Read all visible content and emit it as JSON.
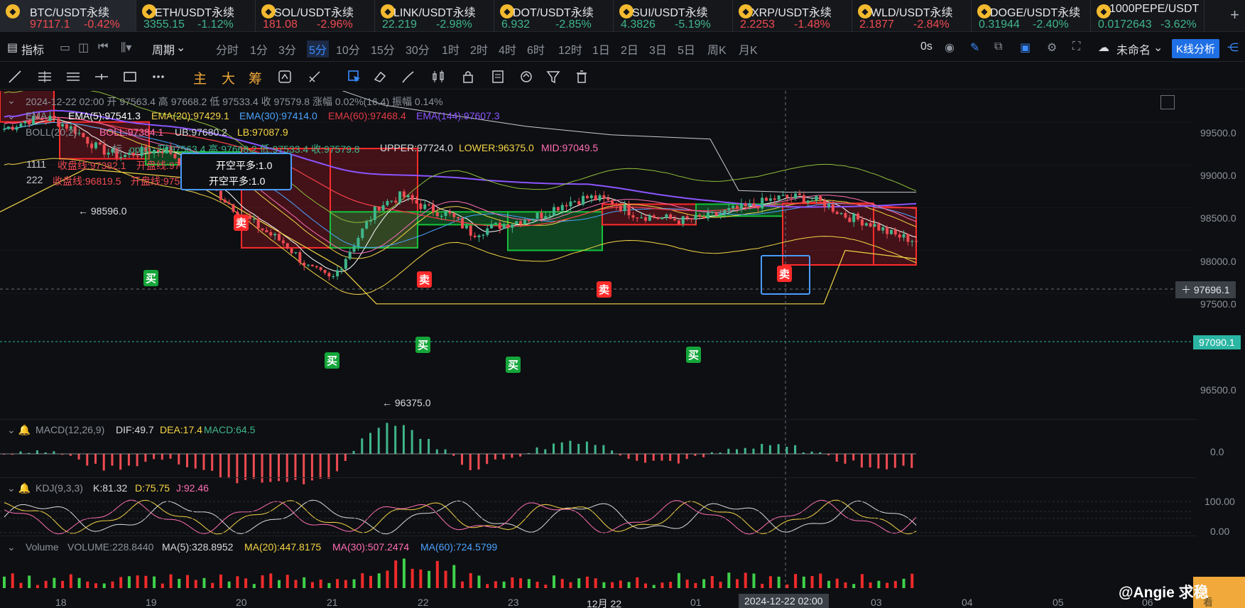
{
  "tickers": [
    {
      "name": "BTC/USDT永续",
      "price": "97117.1",
      "change": "-0.42%",
      "dir": "down",
      "active": true,
      "w": 192
    },
    {
      "name": "ETH/USDT永续",
      "price": "3355.15",
      "change": "-1.12%",
      "dir": "up",
      "w": 168
    },
    {
      "name": "SOL/USDT永续",
      "price": "181.08",
      "change": "-2.96%",
      "dir": "down",
      "w": 168
    },
    {
      "name": "LINK/USDT永续",
      "price": "22.219",
      "change": "-2.98%",
      "dir": "up",
      "w": 168
    },
    {
      "name": "DOT/USDT永续",
      "price": "6.932",
      "change": "-2.85%",
      "dir": "up",
      "w": 168
    },
    {
      "name": "SUI/USDT永续",
      "price": "4.3826",
      "change": "-5.19%",
      "dir": "up",
      "w": 168
    },
    {
      "name": "XRP/USDT永续",
      "price": "2.2253",
      "change": "-1.48%",
      "dir": "down",
      "w": 168
    },
    {
      "name": "WLD/USDT永续",
      "price": "2.1877",
      "change": "-2.84%",
      "dir": "down",
      "w": 168
    },
    {
      "name": "DOGE/USDT永续",
      "price": "0.31944",
      "change": "-2.40%",
      "dir": "up",
      "w": 168
    },
    {
      "name": "1000PEPE/USDT",
      "price": "0.0172643",
      "change": "-3.62%",
      "dir": "up",
      "w": 160
    }
  ],
  "toolbar": {
    "indicator": "指标",
    "period": "周期",
    "intervals": [
      "分时",
      "1分",
      "3分",
      "5分",
      "10分",
      "15分",
      "30分",
      "1时",
      "2时",
      "4时",
      "6时",
      "12时",
      "1日",
      "2日",
      "3日",
      "5日",
      "周K",
      "月K"
    ],
    "active_interval": "5分",
    "timer": "0s",
    "layout_name": "未命名",
    "kline_analysis": "K线分析"
  },
  "drawing": {
    "main": "主",
    "big": "大",
    "chip": "筹"
  },
  "legend": {
    "ohlc": "2024-12-22 02:00  开 97563.4  高 97668.2  低 97533.4  收 97579.8  涨幅 0.02%(16.4)  振幅 0.14%",
    "ema_label": "EMA",
    "ema5": "EMA(5):97541.3",
    "ema20": "EMA(20):97429.1",
    "ema30": "EMA(30):97414.0",
    "ema60": "EMA(60):97468.4",
    "ema144": "EMA(144):97607.3",
    "boll_label": "BOLL(20,2)",
    "boll_mid": "BOLL:97384.1",
    "boll_ub": "UB:97680.2",
    "boll_lb": "LB:97087.9",
    "custom_suffix": "标",
    "custom_open": "open: 开:97563.4 高:97668.2 低:97533.4 收:97579.8",
    "custom_upper": "UPPER:97724.0",
    "custom_lower": "LOWER:96375.0",
    "custom_mid": "MID:97049.5",
    "row1_id": "1111",
    "row1_close": "收盘线:97382.1",
    "row1_open": "开盘线:97563.4",
    "row2_id": "222",
    "row2_close": "收盘线:96819.5",
    "row2_open": "开盘线:97563.4",
    "signal1": "开空平多:1.0",
    "signal2": "开空平多:1.0",
    "high_marker": "98596.0",
    "low_marker": "96375.0"
  },
  "signals": {
    "sell": "卖",
    "buy": "买"
  },
  "price_axis": {
    "ticks": [
      "99500.0",
      "99000.0",
      "98500.0",
      "98000.0",
      "97500.0",
      "96500.0"
    ],
    "crosshair_price": "97696.1",
    "last_price": "97090.1",
    "macd_zero": "0.0",
    "kdj_ticks": [
      "100.00",
      "0.00"
    ]
  },
  "macd": {
    "label": "MACD(12,26,9)",
    "dif": "DIF:49.7",
    "dea": "DEA:17.4",
    "macd": "MACD:64.5"
  },
  "kdj": {
    "label": "KDJ(9,3,3)",
    "k": "K:81.32",
    "d": "D:75.75",
    "j": "J:92.46"
  },
  "volume": {
    "label": "Volume",
    "vol": "VOLUME:228.8440",
    "ma5": "MA(5):328.8952",
    "ma20": "MA(20):447.8175",
    "ma30": "MA(30):507.2474",
    "ma60": "MA(60):724.5799"
  },
  "time_axis": {
    "labels": [
      "18",
      "19",
      "20",
      "21",
      "22",
      "23",
      "12月 22",
      "01",
      "02",
      "03",
      "04",
      "05",
      "06"
    ],
    "crosshair_time": "2024-12-22 02:00",
    "edge": "看"
  },
  "watermark": "@Angie 求稳",
  "colors": {
    "up": "#3fb68b",
    "down": "#ef4b52",
    "accent": "#3a8cff",
    "ema5": "#ffffff",
    "ema20": "#f5d547",
    "ema30": "#4aa3ff",
    "ema60": "#e23b45",
    "ema144": "#8b55ff",
    "boll": "#ff6fb5"
  },
  "chart_data": {
    "type": "candlestick",
    "symbol": "BTC/USDT永续",
    "interval": "5分",
    "x_labels": [
      "18",
      "19",
      "20",
      "21",
      "22",
      "23",
      "12月 22",
      "01",
      "02",
      "03"
    ],
    "close_path": [
      98420,
      98520,
      98540,
      98410,
      98190,
      98100,
      98160,
      98180,
      97900,
      97700,
      97450,
      97250,
      97080,
      96800,
      96650,
      97100,
      97520,
      97640,
      97500,
      97420,
      97200,
      97280,
      97350,
      97420,
      97560,
      97620,
      97560,
      97420,
      97380,
      97350,
      97380,
      97460,
      97520,
      97610,
      97620,
      97560,
      97400,
      97320,
      97180,
      97117
    ]
  }
}
